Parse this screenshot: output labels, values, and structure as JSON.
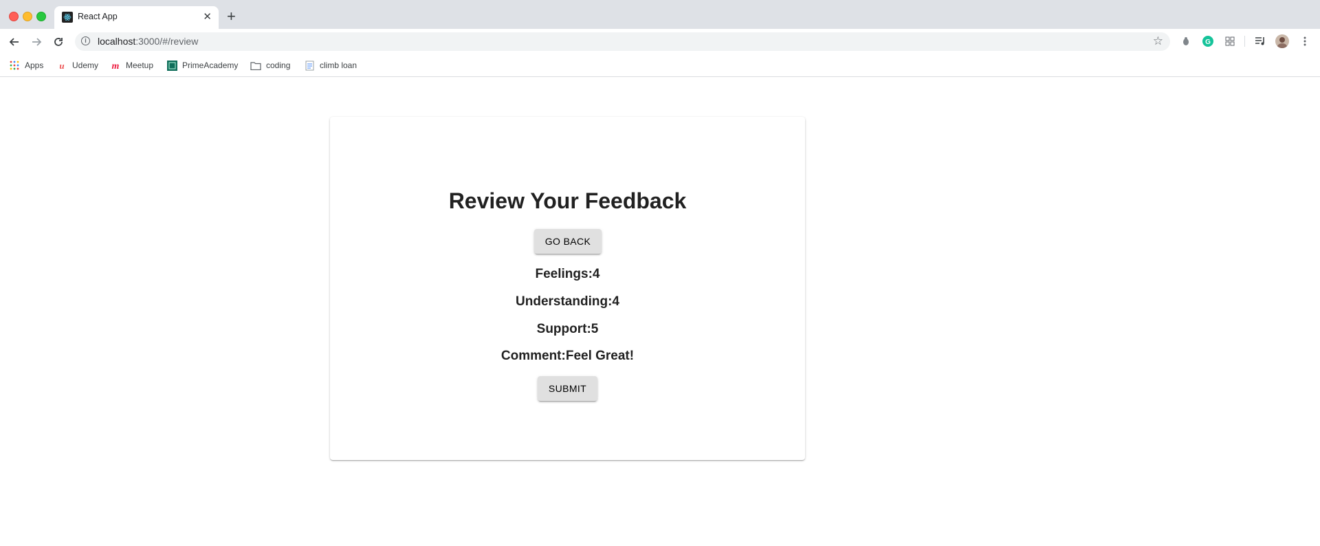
{
  "browser": {
    "tab_title": "React App",
    "url_host": "localhost",
    "url_rest": ":3000/#/review",
    "bookmarks": [
      {
        "label": "Apps",
        "icon": "apps-grid-icon"
      },
      {
        "label": "Udemy",
        "icon": "udemy-icon"
      },
      {
        "label": "Meetup",
        "icon": "meetup-icon"
      },
      {
        "label": "PrimeAcademy",
        "icon": "primeacademy-icon"
      },
      {
        "label": "coding",
        "icon": "folder-icon"
      },
      {
        "label": "climb loan",
        "icon": "document-icon"
      }
    ]
  },
  "page": {
    "heading": "Review Your Feedback",
    "go_back_label": "GO BACK",
    "feelings": "Feelings:4",
    "understanding": "Understanding:4",
    "support": "Support:5",
    "comment": "Comment:Feel Great!",
    "submit_label": "SUBMIT"
  },
  "colors": {
    "tabstrip": "#dee1e6",
    "button_bg": "#e0e0e0",
    "text": "#212121"
  }
}
